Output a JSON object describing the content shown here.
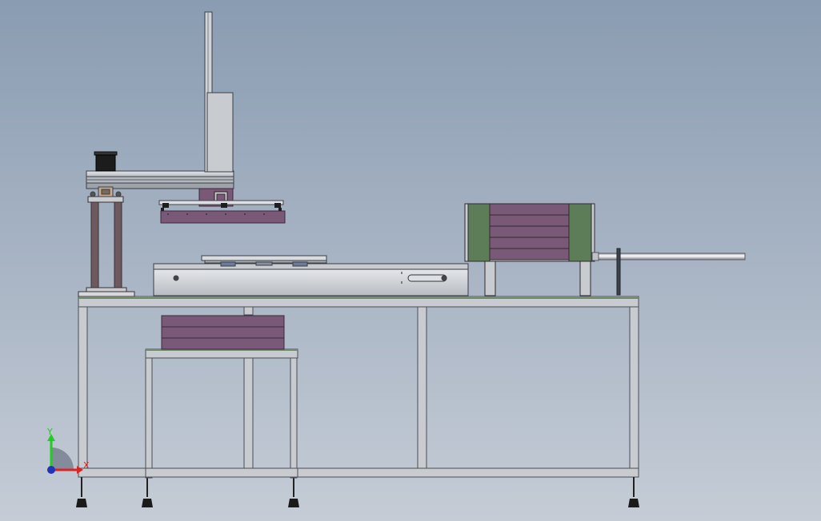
{
  "view": {
    "background_top": "#8a9cb2",
    "background_bottom": "#c5ccd6"
  },
  "colors": {
    "frame": "#c8ccd0",
    "frame_edge": "#4a4e55",
    "tray_purple": "#7a5878",
    "tray_line": "#3a2a3a",
    "guide_green": "#5d7d58",
    "rod_chrome": "#e8eaee",
    "motor_black": "#1c1c1c",
    "post_brown": "#6e5a5e",
    "tabletop_green": "#6d8a6a"
  },
  "triad": {
    "y_label": "Y",
    "x_label": "X",
    "y_color": "#22cc22",
    "x_color": "#dd2222",
    "origin_color": "#2233bb"
  }
}
